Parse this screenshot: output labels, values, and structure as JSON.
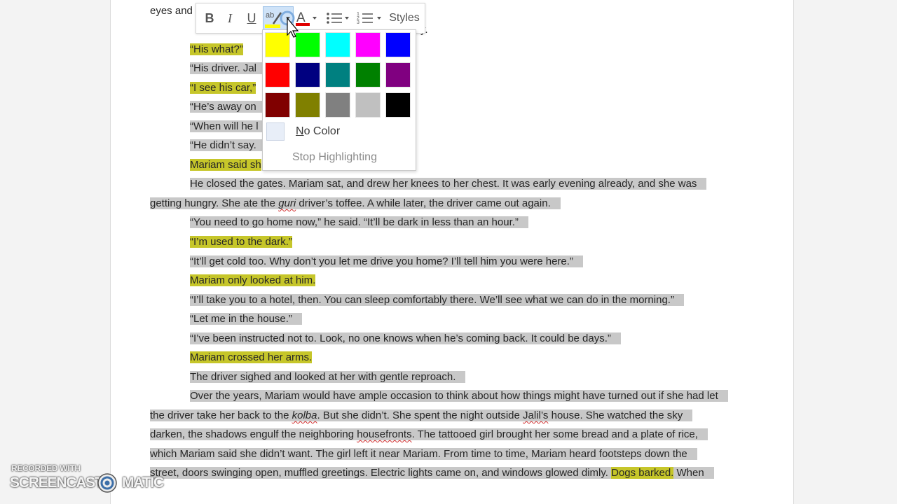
{
  "toolbar": {
    "bold": "B",
    "italic": "I",
    "underline": "U",
    "highlight_glyph": "ab",
    "font_color_glyph": "A",
    "styles": "Styles"
  },
  "palette": {
    "colors": [
      "#ffff00",
      "#00ff00",
      "#00ffff",
      "#ff00ff",
      "#0000ff",
      "#ff0000",
      "#000080",
      "#008080",
      "#008000",
      "#800080",
      "#800000",
      "#808000",
      "#808080",
      "#c0c0c0",
      "#000000"
    ],
    "no_color_prefix": "N",
    "no_color_rest": "o Color",
    "stop_highlighting": "Stop Highlighting"
  },
  "document": {
    "l1": "eyes and",
    "l1b": "y.",
    "l2": "“His what?”",
    "l3": "“His driver. Jal",
    "l4": "“I see his car,”",
    "l5": "“He’s away on",
    "l6": "“When will he l",
    "l7": "“He didn’t say.",
    "l8": "Mariam said sh",
    "l9": "He closed the gates. Mariam sat, and drew her knees to her chest. It was early evening already, and she was",
    "l10a": "getting hungry. She ate the ",
    "l10b": "guri",
    "l10c": " driver’s toffee. A while later, the driver came out again.",
    "l11": "“You need to go home now,” he said. “It’ll be dark in less than an hour.”",
    "l12": "“I’m used to the dark.”",
    "l13": "“It’ll get cold too. Why don’t you let me drive you home? I’ll tell him you were here.”",
    "l14": "Mariam only looked at him.",
    "l15": "“I’ll take you to a hotel, then. You can sleep comfortably there. We’ll see what we can do in the morning.”",
    "l16": "“Let me in the house.”",
    "l17": "“I’ve been instructed not to. Look, no one knows when he’s coming back. It could be days.”",
    "l18": "Mariam crossed her arms.",
    "l19": "The driver sighed and looked at her with gentle reproach.",
    "l20": "Over the years, Mariam would have ample occasion to think about how things might have turned out if she had let",
    "l21a": "the driver take her back to the ",
    "l21b": "kolba",
    "l21c": ". But she didn’t. She spent the night outside ",
    "l21d": "Jalil’s",
    "l21e": " house. She watched the sky",
    "l22a": "darken, the shadows engulf the neighboring ",
    "l22b": "housefronts",
    "l22c": ". The tattooed girl brought her some bread and a plate of rice,",
    "l23": "which Mariam said she didn’t want. The girl left it near Mariam. From time to time, Mariam heard footsteps down the",
    "l24a": "street, doors swinging open, muffled greetings. Electric lights came on, and windows glowed dimly. ",
    "l24b": "Dogs barked.",
    "l24c": " When"
  },
  "watermark": {
    "line1": "RECORDED WITH",
    "line2a": "SCREENCAST",
    "line2b": "MATIC"
  }
}
